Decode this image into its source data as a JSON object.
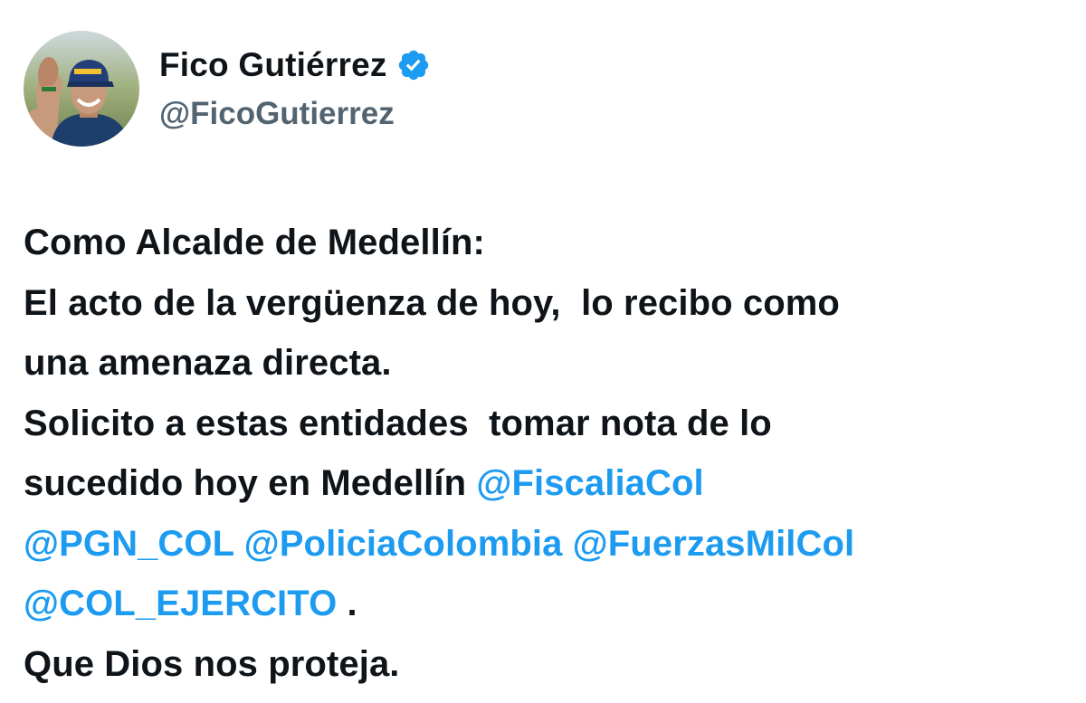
{
  "author": {
    "display_name": "Fico Gutiérrez",
    "handle": "@FicoGutierrez",
    "verified": true,
    "verified_icon": "verified-badge-icon"
  },
  "tweet": {
    "line1": "Como Alcalde de Medellín:",
    "line2": "El acto de la vergüenza de hoy,  lo recibo como",
    "line3": "una amenaza directa.",
    "line4": "Solicito a estas entidades  tomar nota de lo",
    "line5_text": "sucedido hoy en Medellín ",
    "mentions": [
      "@FiscaliaCol",
      "@PGN_COL",
      "@PoliciaColombia",
      "@FuerzasMilCol",
      "@COL_EJERCITO"
    ],
    "after_last_mention": " .",
    "line8": "Que Dios nos proteja."
  },
  "colors": {
    "text": "#0f1419",
    "secondary": "#536471",
    "link": "#1d9bf0",
    "verified": "#1d9bf0"
  }
}
